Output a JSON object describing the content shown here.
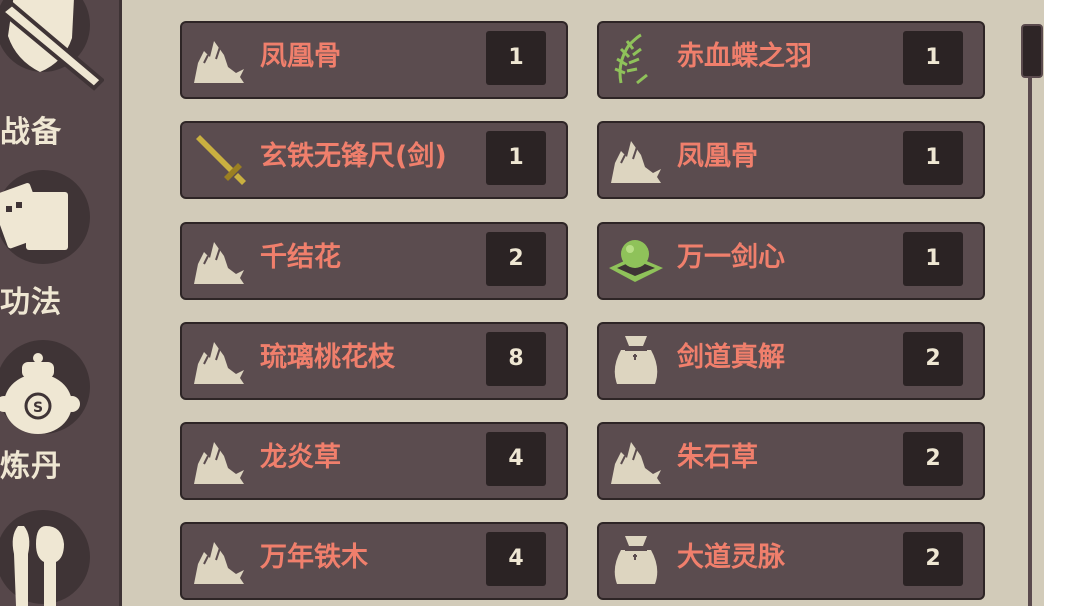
{
  "sidebar": {
    "tabs": [
      {
        "label": "战备",
        "icon": "shield-sword-icon"
      },
      {
        "label": "功法",
        "icon": "scroll-books-icon"
      },
      {
        "label": "炼丹",
        "icon": "alchemy-cauldron-icon"
      },
      {
        "label": "",
        "icon": "spoon-icon"
      }
    ]
  },
  "inventory": {
    "items": [
      {
        "name": "凤凰骨",
        "count": "1",
        "icon": "rock-material-icon"
      },
      {
        "name": "赤血蝶之羽",
        "count": "1",
        "icon": "feather-icon"
      },
      {
        "name": "玄铁无锋尺(剑)",
        "count": "1",
        "icon": "sword-icon"
      },
      {
        "name": "凤凰骨",
        "count": "1",
        "icon": "rock-material-icon"
      },
      {
        "name": "千结花",
        "count": "2",
        "icon": "rock-material-icon"
      },
      {
        "name": "万一剑心",
        "count": "1",
        "icon": "green-orb-icon"
      },
      {
        "name": "琉璃桃花枝",
        "count": "8",
        "icon": "rock-material-icon"
      },
      {
        "name": "剑道真解",
        "count": "2",
        "icon": "pouch-icon"
      },
      {
        "name": "龙炎草",
        "count": "4",
        "icon": "rock-material-icon"
      },
      {
        "name": "朱石草",
        "count": "2",
        "icon": "rock-material-icon"
      },
      {
        "name": "万年铁木",
        "count": "4",
        "icon": "rock-material-icon"
      },
      {
        "name": "大道灵脉",
        "count": "2",
        "icon": "pouch-icon"
      }
    ]
  },
  "colors": {
    "item_name": "#f07f6c",
    "panel_bg": "#d2cbb9",
    "slot_bg": "#5b4c4f",
    "sidebar_bg": "#56474a"
  }
}
